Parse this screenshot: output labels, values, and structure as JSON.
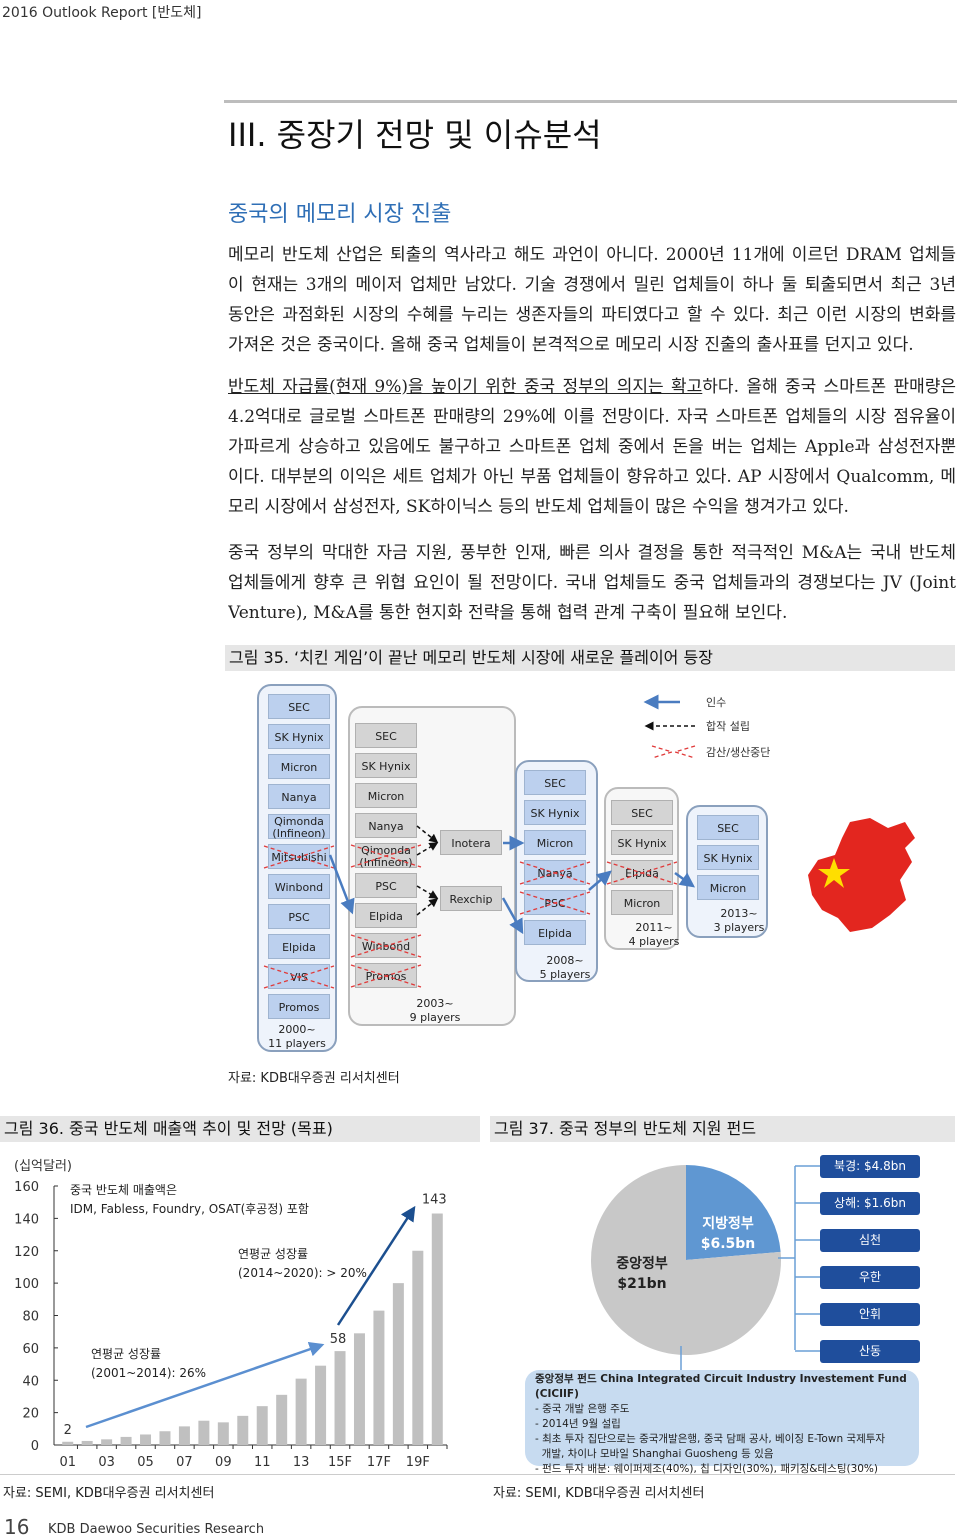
{
  "header": {
    "text": "2016 Outlook Report [반도체]"
  },
  "section": {
    "title": "III. 중장기 전망 및 이슈분석",
    "subtitle": "중국의 메모리 시장 진출"
  },
  "paragraphs": [
    {
      "lines": [
        "메모리 반도체 산업은 퇴출의 역사라고 해도 과언이 아니다. 2000년 11개에 이르던 DRAM 업체들",
        "이 현재는 3개의 메이저 업체만 남았다. 기술 경쟁에서 밀린 업체들이 하나 둘 퇴출되면서 최근 3년",
        "동안은 과점화된 시장의 수혜를 누리는 생존자들의 파티였다고 할 수 있다. 최근 이런 시장의 변화를",
        "가져온 것은 중국이다. 올해 중국 업체들이 본격적으로 메모리 시장 진출의 출사표를 던지고 있다."
      ]
    },
    {
      "underlined": "반도체 자급률(현재 9%)을 높이기 위한 중국 정부의 의지는 확고",
      "first_rest": "하다. 올해 중국 스마트폰 판매량은",
      "lines": [
        "4.2억대로 글로벌 스마트폰 판매량의 29%에 이를 전망이다. 자국 스마트폰 업체들의 시장 점유율이",
        "가파르게 상승하고 있음에도 불구하고 스마트폰 업체 중에서 돈을 버는 업체는 Apple과 삼성전자뿐",
        "이다. 대부분의 이익은 세트 업체가 아닌 부품 업체들이 향유하고 있다. AP 시장에서 Qualcomm, 메",
        "모리 시장에서 삼성전자, SK하이닉스 등의 반도체 업체들이 많은 수익을 챙겨가고 있다."
      ]
    },
    {
      "lines": [
        "중국 정부의 막대한 자금 지원, 풍부한 인재, 빠른 의사 결정을 통한 적극적인 M&A는 국내 반도체",
        "업체들에게 향후 큰 위협 요인이 될 전망이다. 국내 업체들도 중국 업체들과의 경쟁보다는 JV (Joint",
        "Venture), M&A를 통한 현지화 전략을 통해 협력 관계 구축이 필요해 보인다."
      ]
    }
  ],
  "figure35": {
    "caption": "그림 35. ‘치킨 게임’이 끝난 메모리 반도체 시장에 새로운 플레이어 등장",
    "source": "자료: KDB대우증권 리서치센터",
    "legend": {
      "acquisition": "인수",
      "joint_venture": "합작 설립",
      "cut": "감산/생산중단"
    },
    "columns": [
      {
        "period": "2000~",
        "players": "11 players",
        "items": [
          "SEC",
          "SK Hynix",
          "Micron",
          "Nanya",
          "Qimonda (Infineon)",
          "Mitsubishi",
          "Winbond",
          "PSC",
          "Elpida",
          "VIS",
          "Promos"
        ],
        "crossed": [
          "Mitsubishi",
          "VIS"
        ]
      },
      {
        "period": "2003~",
        "players": "9 players",
        "items": [
          "SEC",
          "SK Hynix",
          "Micron",
          "Nanya",
          "Qimonda (Infineon)",
          "PSC",
          "Elpida",
          "Winbond",
          "Promos"
        ],
        "crossed": [
          "Qimonda (Infineon)",
          "Winbond",
          "Promos"
        ]
      },
      {
        "period": "2008~",
        "players": "5 players",
        "items": [
          "SEC",
          "SK Hynix",
          "Micron",
          "Nanya",
          "PSC",
          "Elpida"
        ],
        "crossed": [
          "Nanya",
          "PSC"
        ]
      },
      {
        "period": "2011~",
        "players": "4 players",
        "items": [
          "SEC",
          "SK Hynix",
          "Elpida",
          "Micron"
        ],
        "crossed": [
          "Elpida"
        ]
      },
      {
        "period": "2013~",
        "players": "3 players",
        "items": [
          "SEC",
          "SK Hynix",
          "Micron"
        ],
        "crossed": []
      }
    ],
    "joint_ventures": [
      "Inotera",
      "Rexchip"
    ],
    "colors": {
      "blue_box": "#bcd0ee",
      "gray_box": "#d4d4d4",
      "arrow": "#4a7cc0",
      "cross": "#e03a3a",
      "china_red": "#e3261f",
      "star": "#ffde00"
    }
  },
  "figure36": {
    "caption": "그림 36. 중국 반도체 매출액 추이 및 전망 (목표)",
    "source": "자료: SEMI, KDB대우증권 리서치센터"
  },
  "figure37": {
    "caption": "그림 37. 중국 정부의 반도체 지원 펀드",
    "source": "자료: SEMI, KDB대우증권 리서치센터",
    "local_funds": [
      "북경: $4.8bn",
      "상해: $1.6bn",
      "심천",
      "우한",
      "안휘",
      "산동"
    ],
    "info": {
      "title": "중앙정부 펀드 China Integrated Circuit Industry Investement Fund (CICIIF)",
      "bullets": [
        "- 중국 개발 은행 주도",
        "- 2014년 9월 설립",
        "- 최초 투자 집단으로는 중국개발은행, 중국 담패 공사, 베이징 E-Town 국제투자",
        "  개발, 차이나 모바일 Shanghai Guosheng 등 있음",
        "- 펀드 투자 배분: 웨이퍼제조(40%), 칩 디자인(30%), 패키징&테스팅(30%)"
      ]
    }
  },
  "chart_data": [
    {
      "type": "bar",
      "unit_label": "(십억달러)",
      "categories": [
        "01",
        "02",
        "03",
        "04",
        "05",
        "06",
        "07",
        "08",
        "09",
        "10",
        "11",
        "12",
        "13",
        "14",
        "15F",
        "16F",
        "17F",
        "18F",
        "19F",
        "20F"
      ],
      "tick_labels": [
        "01",
        "03",
        "05",
        "07",
        "09",
        "11",
        "13",
        "15F",
        "17F",
        "19F"
      ],
      "values": [
        2,
        2.5,
        3.5,
        5,
        6.5,
        8.5,
        11.5,
        15,
        14,
        18,
        24,
        31,
        41,
        49,
        58,
        69,
        83,
        100,
        120,
        143
      ],
      "ylim": [
        0,
        160
      ],
      "yticks": [
        0,
        20,
        40,
        60,
        80,
        100,
        120,
        140,
        160
      ],
      "data_labels": {
        "first": "2",
        "mid": "58",
        "last": "143"
      },
      "annotations": {
        "note_line1": "중국 반도체 매출액은",
        "note_line2": "IDM, Fabless, Foundry, OSAT(후공정) 포함",
        "cagr1_line1": "연평균 성장률",
        "cagr1_line2": "(2001~2014): 26%",
        "cagr2_line1": "연평균 성장률",
        "cagr2_line2": "(2014~2020): > 20%"
      },
      "bar_color": "#c0c0c0",
      "arrow_colors": [
        "#5b8fd0",
        "#1c4f8f"
      ]
    },
    {
      "type": "pie",
      "slices": [
        {
          "name": "지방정부",
          "label": "$6.5bn",
          "value": 6.5,
          "color": "#5f97d2"
        },
        {
          "name": "중앙정부",
          "label": "$21bn",
          "value": 21,
          "color": "#c8c8c8"
        }
      ]
    }
  ],
  "footer": {
    "page": "16",
    "text": "KDB Daewoo Securities Research"
  }
}
